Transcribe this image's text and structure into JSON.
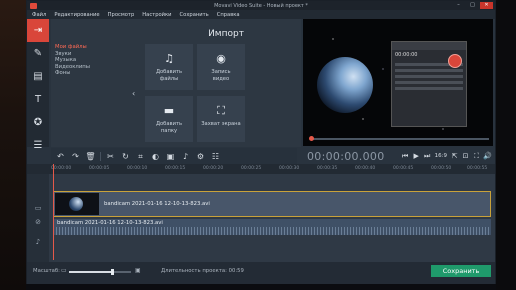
{
  "window": {
    "title": "Movavi Video Suite - Новый проект *",
    "controls": [
      "–",
      "□",
      "✕"
    ]
  },
  "menu": [
    "Файл",
    "Редактирование",
    "Просмотр",
    "Настройки",
    "Сохранить",
    "Справка"
  ],
  "import": {
    "title": "Импорт",
    "categories": [
      "Мои файлы",
      "Звуки",
      "Музыка",
      "Видеоклипы",
      "Фоны"
    ],
    "tiles": [
      {
        "label": "Добавить\nфайлы",
        "icon": "music-file-icon"
      },
      {
        "label": "Запись\nвидео",
        "icon": "camera-icon"
      },
      {
        "label": "Добавить\nпапку",
        "icon": "folder-icon"
      },
      {
        "label": "Захват экрана",
        "icon": "screen-capture-icon"
      }
    ]
  },
  "player": {
    "timecode": "00:00:00.000",
    "aspect": "16:9",
    "recorder_time": "00:00:00"
  },
  "timeline": {
    "ticks": [
      "00:00:00",
      "00:00:05",
      "00:00:10",
      "00:00:15",
      "00:00:20",
      "00:00:25",
      "00:00:30",
      "00:00:35",
      "00:00:40",
      "00:00:45",
      "00:00:50",
      "00:00:55"
    ],
    "video_clip": "bandicam 2021-01-16 12-10-13-823.avi",
    "audio_clip": "bandicam 2021-01-16 12-10-13-823.avi"
  },
  "footer": {
    "zoom_label": "Масштаб:",
    "zoom_level": 0.7,
    "duration_label": "Длительность проекта:",
    "duration_value": "00:59",
    "save_label": "Сохранить"
  },
  "colors": {
    "accent": "#d9463a",
    "save": "#1f9a6b",
    "clip_border": "#c9a23a"
  }
}
